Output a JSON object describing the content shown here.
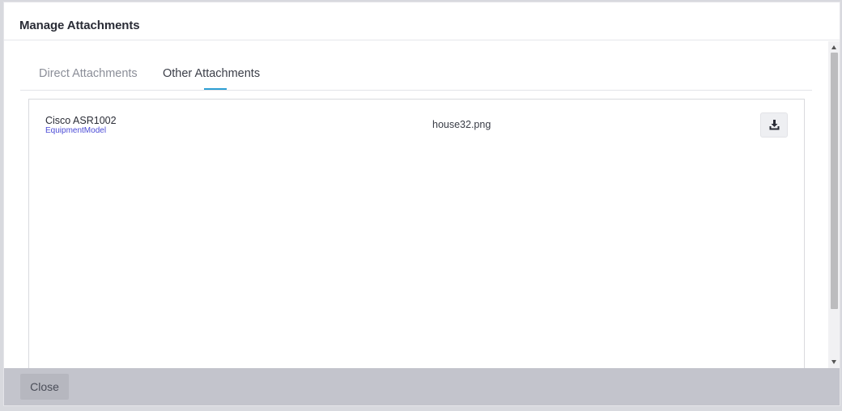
{
  "modal": {
    "title": "Manage Attachments"
  },
  "tabs": [
    {
      "label": "Direct Attachments",
      "active": false
    },
    {
      "label": "Other Attachments",
      "active": true
    }
  ],
  "attachments": [
    {
      "name": "Cisco ASR1002",
      "type": "EquipmentModel",
      "file": "house32.png",
      "action_icon": "download-icon"
    }
  ],
  "footer": {
    "close_label": "Close"
  },
  "colors": {
    "accent": "#2e9fd4",
    "type_link": "#4b4bd6",
    "footer_bg": "#c3c4cc"
  }
}
